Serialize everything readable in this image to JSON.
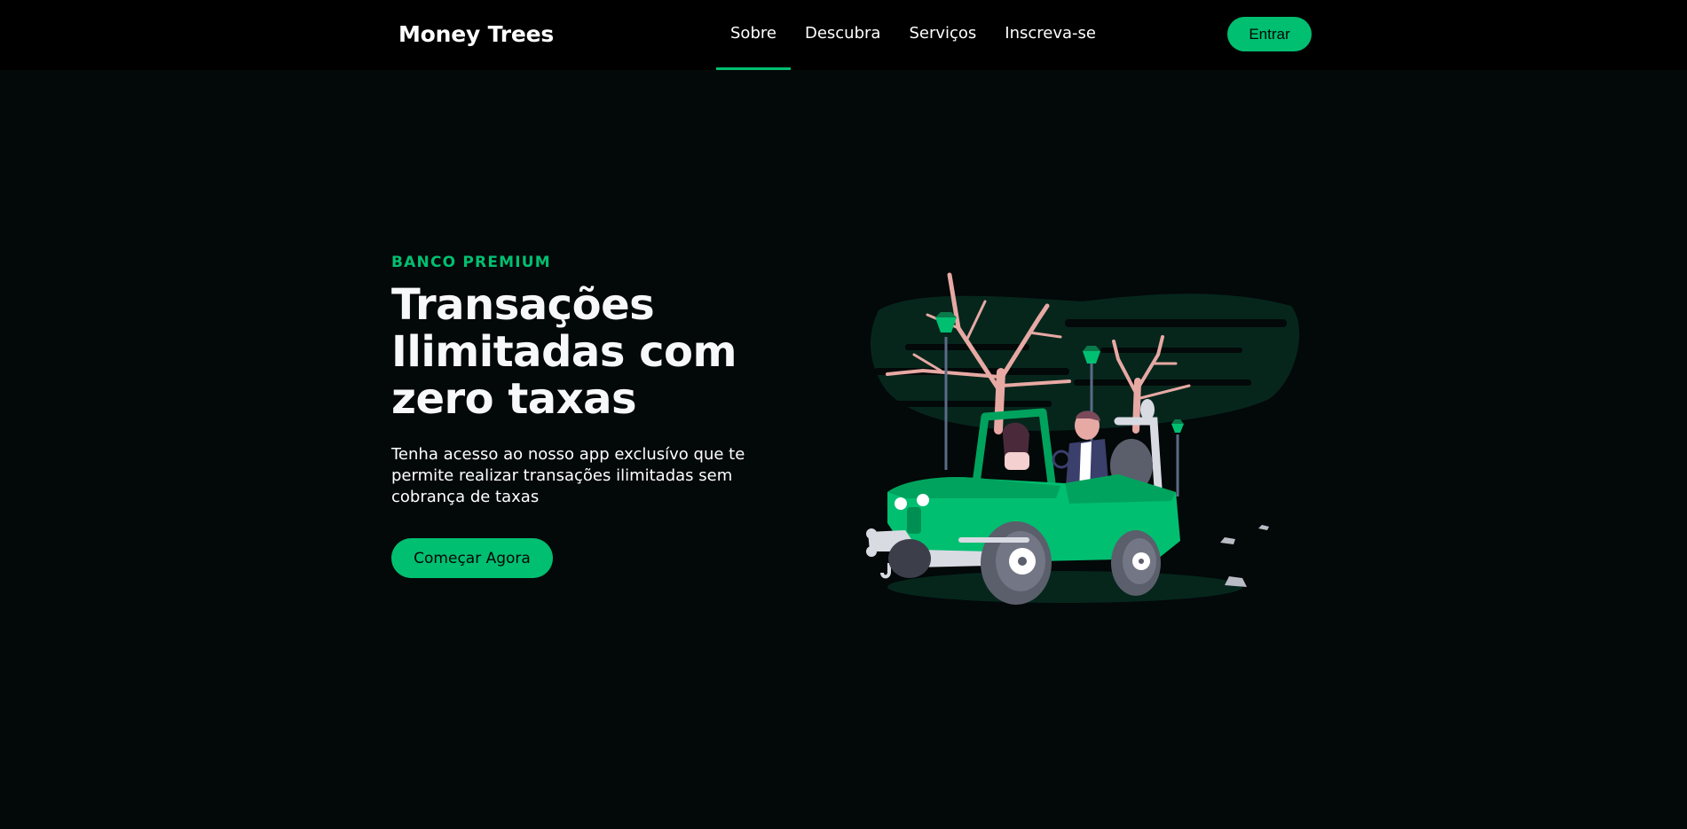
{
  "nav": {
    "brand": "Money Trees",
    "links": [
      {
        "label": "Sobre",
        "active": true
      },
      {
        "label": "Descubra",
        "active": false
      },
      {
        "label": "Serviços",
        "active": false
      },
      {
        "label": "Inscreva-se",
        "active": false
      }
    ],
    "signin_label": "Entrar"
  },
  "hero": {
    "eyebrow": "BANCO PREMIUM",
    "headline_lines": [
      "Transações",
      "Ilimitadas com",
      "zero taxas"
    ],
    "description": "Tenha acesso ao nosso app exclusívo que te permite realizar transações ilimitadas sem cobrança de taxas",
    "cta_label": "Começar Agora",
    "illustration": "green-jeep-with-couple-illustration"
  },
  "colors": {
    "accent": "#01bf71",
    "background": "#030808",
    "navbar": "#000000",
    "text": "#ffffff"
  }
}
